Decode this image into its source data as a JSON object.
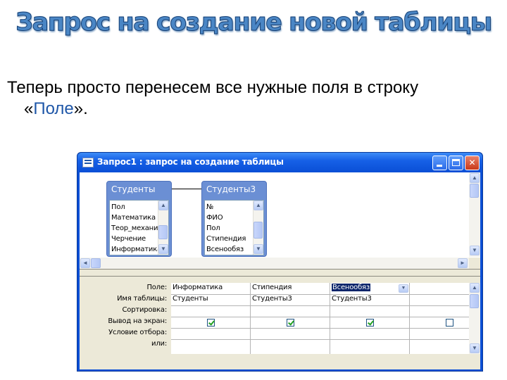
{
  "slide": {
    "title": "Запрос на создание новой таблицы",
    "text_line1": "Теперь просто перенесем все нужные поля в строку",
    "text_open_quote": "«",
    "text_highlight": "Поле",
    "text_close": "».",
    "title_color": "#4a86c5"
  },
  "window": {
    "title": "Запрос1 : запрос на создание таблицы",
    "buttons": {
      "minimize": "minimize-icon",
      "maximize": "maximize-icon",
      "close": "✕"
    },
    "titlebar_color": "#0a4fd6"
  },
  "tables": [
    {
      "name": "Студенты",
      "fields": [
        "Пол",
        "Математика",
        "Теор_механи",
        "Черчение",
        "Информатика"
      ]
    },
    {
      "name": "Студенты3",
      "fields": [
        "№",
        "ФИО",
        "Пол",
        "Стипендия",
        "Всенообяз"
      ]
    }
  ],
  "grid": {
    "row_labels": [
      "Поле:",
      "Имя таблицы:",
      "Сортировка:",
      "Вывод на экран:",
      "Условие отбора:",
      "или:"
    ],
    "columns": [
      {
        "field": "Информатика",
        "table": "Студенты",
        "show": true
      },
      {
        "field": "Стипендия",
        "table": "Студенты3",
        "show": true
      },
      {
        "field": "Всенообяз",
        "table": "Студенты3",
        "show": true,
        "selected": true
      },
      {
        "field": "",
        "table": "",
        "show": false
      }
    ]
  },
  "scroll": {
    "up": "▲",
    "down": "▼",
    "left": "◄",
    "right": "►"
  }
}
